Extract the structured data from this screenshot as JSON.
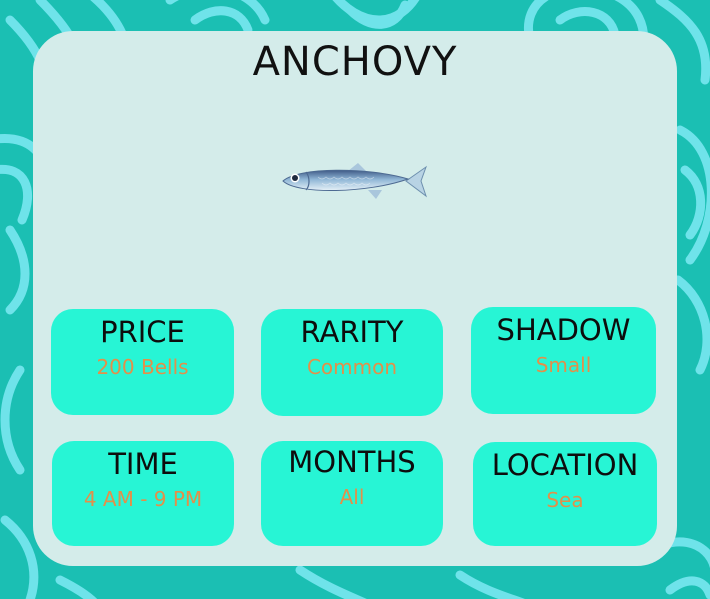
{
  "card": {
    "title": "ANCHOVY"
  },
  "stats": [
    {
      "label": "PRICE",
      "value": "200 Bells"
    },
    {
      "label": "RARITY",
      "value": "Common"
    },
    {
      "label": "SHADOW",
      "value": "Small"
    },
    {
      "label": "TIME",
      "value": "4 AM - 9 PM"
    },
    {
      "label": "MONTHS",
      "value": "All"
    },
    {
      "label": "LOCATION",
      "value": "Sea"
    }
  ],
  "icons": {
    "fish": "anchovy-fish-icon",
    "background": "leaf-pattern"
  },
  "colors": {
    "background": "#1bbfb3",
    "leaf_pattern": "#6fe3ea",
    "card": "#d4ecea",
    "tile": "#27f5d5",
    "label_text": "#0d0d0d",
    "value_text": "#e2904a"
  }
}
